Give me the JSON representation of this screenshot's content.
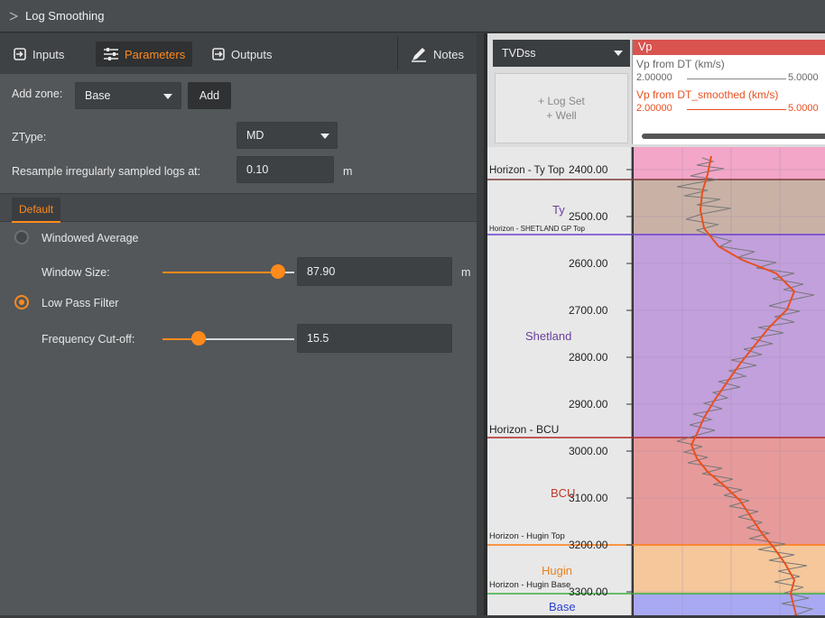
{
  "window": {
    "title": "Log Smoothing"
  },
  "tabs": {
    "inputs": "Inputs",
    "parameters": "Parameters",
    "outputs": "Outputs",
    "notes": "Notes"
  },
  "zone": {
    "label": "Add zone:",
    "value": "Base",
    "add_button": "Add"
  },
  "ztype": {
    "label": "ZType:",
    "value": "MD"
  },
  "resample": {
    "label": "Resample irregularly sampled logs at:",
    "value": "0.10",
    "unit": "m"
  },
  "zone_tab": "Default",
  "windowed": {
    "label": "Windowed Average",
    "selected": false,
    "size_label": "Window Size:",
    "size_value": "87.90",
    "unit": "m",
    "slider_fraction": 0.88
  },
  "lowpass": {
    "label": "Low Pass Filter",
    "selected": true,
    "cutoff_label": "Frequency Cut-off:",
    "cutoff_value": "15.5",
    "slider_fraction": 0.2
  },
  "viewer": {
    "depth_type": "TVDss",
    "add_log_set": "+ Log Set",
    "add_well": "+ Well",
    "track_title": "Vp",
    "curve1": {
      "name": "Vp from DT (km/s)",
      "min": "2.00000",
      "max": "5.0000",
      "color": "#555555"
    },
    "curve2": {
      "name": "Vp from DT_smoothed (km/s)",
      "min": "2.00000",
      "max": "5.0000",
      "color": "#e8501f"
    }
  },
  "depth_labels": [
    "2400.00",
    "2500.00",
    "2600.00",
    "2700.00",
    "2800.00",
    "2900.00",
    "3000.00",
    "3100.00",
    "3200.00",
    "3300.00"
  ],
  "zones": [
    {
      "name": "Ty",
      "color": "#6a3fa0"
    },
    {
      "name": "Shetland",
      "color": "#6a3fa0"
    },
    {
      "name": "BCU",
      "color": "#c0392b"
    },
    {
      "name": "Hugin",
      "color": "#e8801f"
    },
    {
      "name": "Base",
      "color": "#2a3fd0"
    }
  ],
  "horizons": {
    "ty_top": "Horizon - Ty Top",
    "shetland_gp_top": "Horizon - SHETLAND GP Top",
    "bcu": "Horizon - BCU",
    "hugin_top": "Horizon - Hugin Top",
    "hugin_base": "Horizon - Hugin Base"
  }
}
